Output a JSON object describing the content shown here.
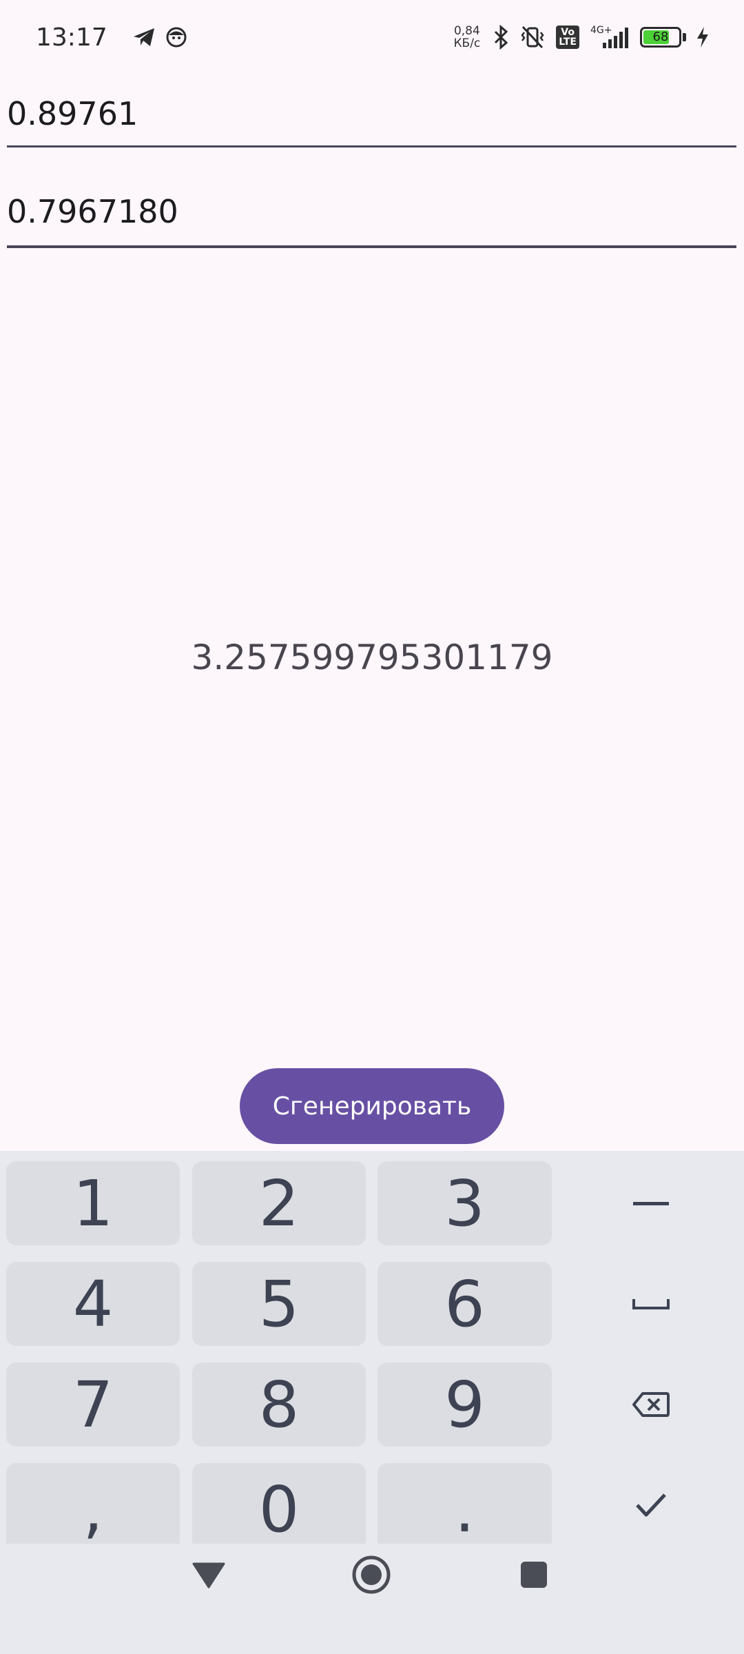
{
  "status_bar": {
    "time": "13:17",
    "net_speed_value": "0,84",
    "net_speed_unit": "КБ/с",
    "volte_label": "Vo\nLTE",
    "network_type": "4G+",
    "battery_level": "68",
    "battery_percent": 68
  },
  "inputs": {
    "first_value": "0.89761",
    "second_value": "0.7967180"
  },
  "result_text": "3.257599795301179",
  "generate_button_label": "Сгенерировать",
  "keyboard": {
    "row1": [
      "1",
      "2",
      "3"
    ],
    "row2": [
      "4",
      "5",
      "6"
    ],
    "row3": [
      "7",
      "8",
      "9"
    ],
    "row4": [
      ",",
      "0",
      "."
    ],
    "side_keys": [
      "minus-icon",
      "space-icon",
      "backspace-icon",
      "done-check-icon"
    ]
  },
  "navbar": [
    "back-icon",
    "home-icon",
    "recents-icon"
  ],
  "colors": {
    "accent": "#6750a4",
    "background": "#fdf7fc",
    "battery": "#4cd137"
  }
}
